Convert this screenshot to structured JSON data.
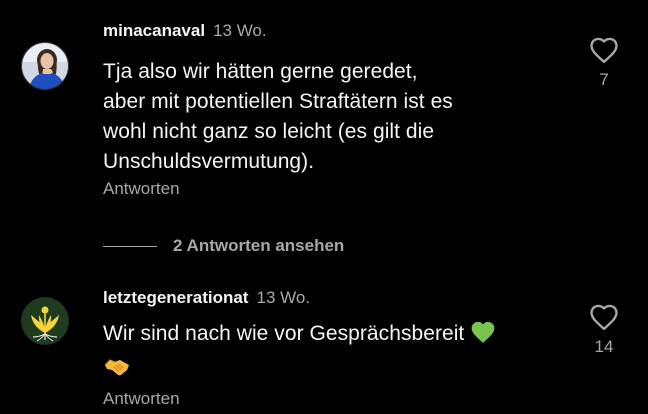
{
  "comments": [
    {
      "username": "minacanaval",
      "time": "13 Wo.",
      "text_lines": [
        "Tja also wir hätten gerne geredet,",
        "aber mit potentiellen Straftätern ist es",
        "wohl nicht ganz so leicht (es gilt die",
        "Unschuldsvermutung)."
      ],
      "reply_label": "Antworten",
      "likes": "7",
      "like_icon": "heart-outline-icon"
    },
    {
      "username": "letztegenerationat",
      "time": "13 Wo.",
      "text_line1": "Wir sind nach wie vor Gesprächsbereit",
      "emoji_1": "green-heart-emoji",
      "emoji_2": "handshake-emoji",
      "reply_label": "Antworten",
      "likes": "14",
      "like_icon": "heart-outline-icon"
    }
  ],
  "view_replies": {
    "label": "2 Antworten ansehen"
  },
  "colors": {
    "background": "#000000",
    "primary_text": "#f5f5f5",
    "secondary_text": "#a8a8a8",
    "green_heart": "#7bc24e",
    "handshake": "#f6b93b"
  }
}
